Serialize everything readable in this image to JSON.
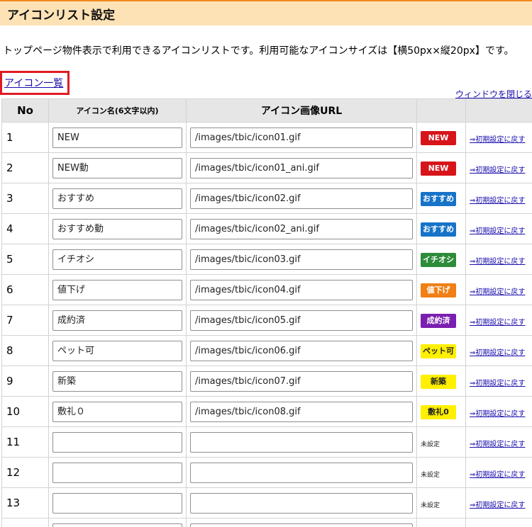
{
  "header": {
    "title": "アイコンリスト設定"
  },
  "description": "トップページ物件表示で利用できるアイコンリストです。利用可能なアイコンサイズは【横50px×縦20px】です。",
  "icon_list_link": "アイコン一覧",
  "close_window_link": "ウィンドウを閉じる",
  "table": {
    "headers": {
      "no": "No",
      "name": "アイコン名(6文字以内)",
      "url": "アイコン画像URL",
      "preview": "",
      "reset": ""
    },
    "reset_label": "⇒初期設定に戻す",
    "unset_label": "未設定",
    "rows": [
      {
        "no": "1",
        "name": "NEW",
        "url": "/images/tbic/icon01.gif",
        "badge": {
          "text": "NEW",
          "bg": "#d7141a",
          "fg": "#ffffff"
        }
      },
      {
        "no": "2",
        "name": "NEW動",
        "url": "/images/tbic/icon01_ani.gif",
        "badge": {
          "text": "NEW",
          "bg": "#d7141a",
          "fg": "#ffffff"
        }
      },
      {
        "no": "3",
        "name": "おすすめ",
        "url": "/images/tbic/icon02.gif",
        "badge": {
          "text": "おすすめ",
          "bg": "#1673c8",
          "fg": "#ffffff"
        }
      },
      {
        "no": "4",
        "name": "おすすめ動",
        "url": "/images/tbic/icon02_ani.gif",
        "badge": {
          "text": "おすすめ",
          "bg": "#1673c8",
          "fg": "#ffffff"
        }
      },
      {
        "no": "5",
        "name": "イチオシ",
        "url": "/images/tbic/icon03.gif",
        "badge": {
          "text": "イチオシ",
          "bg": "#2e8b3a",
          "fg": "#ffffff"
        }
      },
      {
        "no": "6",
        "name": "値下げ",
        "url": "/images/tbic/icon04.gif",
        "badge": {
          "text": "値下げ",
          "bg": "#f07f16",
          "fg": "#ffffff"
        }
      },
      {
        "no": "7",
        "name": "成約済",
        "url": "/images/tbic/icon05.gif",
        "badge": {
          "text": "成約済",
          "bg": "#7a1fb0",
          "fg": "#ffffff"
        }
      },
      {
        "no": "8",
        "name": "ペット可",
        "url": "/images/tbic/icon06.gif",
        "badge": {
          "text": "ペット可",
          "bg": "#ffef00",
          "fg": "#222222"
        }
      },
      {
        "no": "9",
        "name": "新築",
        "url": "/images/tbic/icon07.gif",
        "badge": {
          "text": "新築",
          "bg": "#ffef00",
          "fg": "#222222"
        }
      },
      {
        "no": "10",
        "name": "敷礼０",
        "url": "/images/tbic/icon08.gif",
        "badge": {
          "text": "敷礼0",
          "bg": "#ffef00",
          "fg": "#222222"
        }
      },
      {
        "no": "11",
        "name": "",
        "url": "",
        "badge": null
      },
      {
        "no": "12",
        "name": "",
        "url": "",
        "badge": null
      },
      {
        "no": "13",
        "name": "",
        "url": "",
        "badge": null
      },
      {
        "no": "",
        "name": "",
        "url": "",
        "badge": null
      }
    ]
  }
}
